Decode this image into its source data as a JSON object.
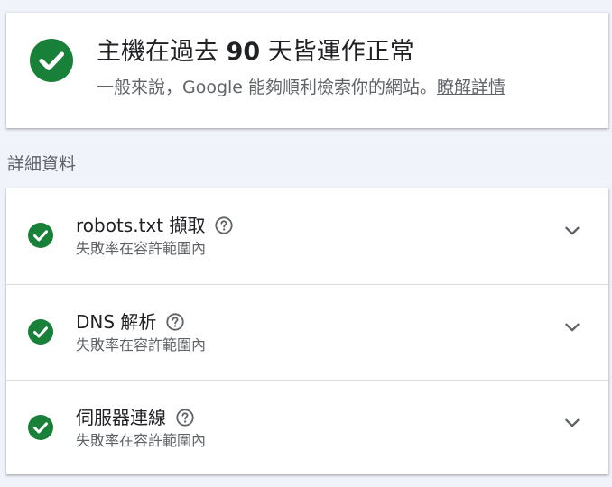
{
  "summary": {
    "title_prefix": "主機在過去 ",
    "title_number": "90",
    "title_suffix": " 天皆運作正常",
    "subtitle": "一般來說，Google 能夠順利檢索你的網站。",
    "learn_more_link": "瞭解詳情",
    "status_icon": "check-circle-icon"
  },
  "details": {
    "heading": "詳細資料",
    "items": [
      {
        "title": "robots.txt 擷取",
        "description": "失敗率在容許範圍內",
        "status_icon": "check-circle-icon",
        "help_icon": "help-circle-icon",
        "expand_icon": "chevron-down-icon"
      },
      {
        "title": "DNS 解析",
        "description": "失敗率在容許範圍內",
        "status_icon": "check-circle-icon",
        "help_icon": "help-circle-icon",
        "expand_icon": "chevron-down-icon"
      },
      {
        "title": "伺服器連線",
        "description": "失敗率在容許範圍內",
        "status_icon": "check-circle-icon",
        "help_icon": "help-circle-icon",
        "expand_icon": "chevron-down-icon"
      }
    ]
  },
  "colors": {
    "success_green": "#188038",
    "page_background": "#f1f3fa",
    "card_background": "#ffffff",
    "primary_text": "#202124",
    "secondary_text": "#5f6368",
    "icon_grey": "#5f6368",
    "divider": "#dadce0"
  }
}
